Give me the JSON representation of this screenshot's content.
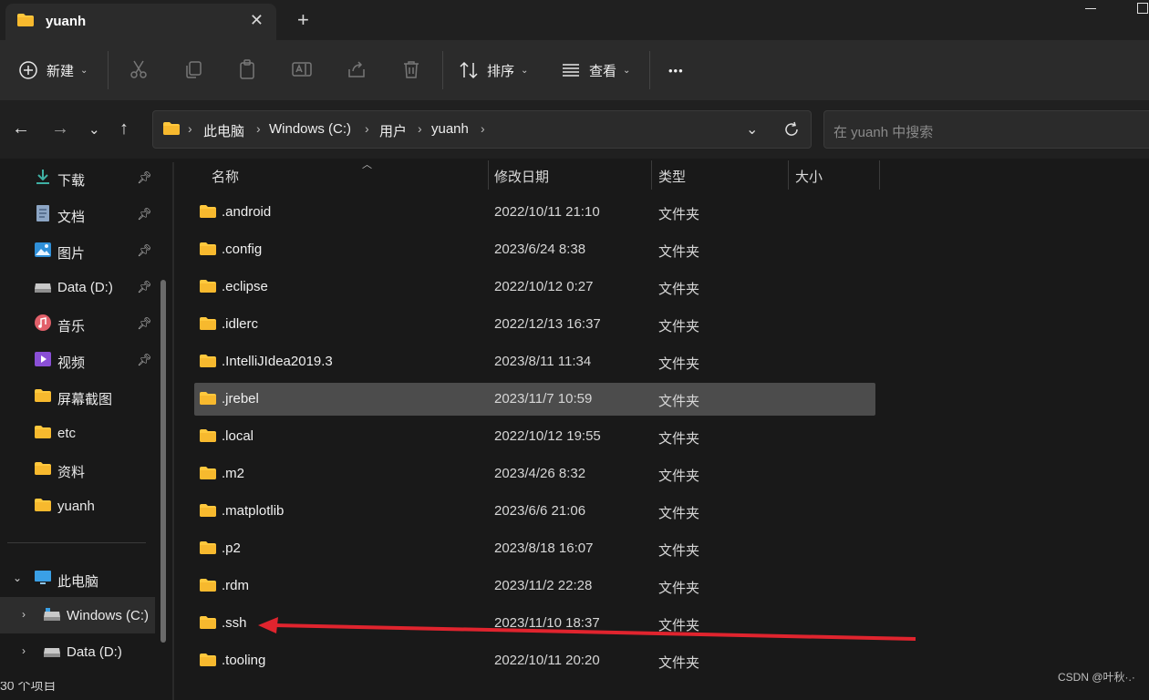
{
  "window": {
    "tab_title": "yuanh",
    "close_tab": "✕",
    "new_tab": "+"
  },
  "toolbar": {
    "new_label": "新建",
    "sort_label": "排序",
    "view_label": "查看",
    "more_label": "•••"
  },
  "nav": {
    "breadcrumbs": [
      "此电脑",
      "Windows (C:)",
      "用户",
      "yuanh"
    ],
    "search_placeholder": "在 yuanh 中搜索"
  },
  "sidebar": {
    "quick_access": [
      {
        "label": "下载",
        "icon": "download-icon",
        "pinned": true
      },
      {
        "label": "文档",
        "icon": "document-icon",
        "pinned": true
      },
      {
        "label": "图片",
        "icon": "picture-icon",
        "pinned": true
      },
      {
        "label": "Data (D:)",
        "icon": "drive-icon",
        "pinned": true
      },
      {
        "label": "音乐",
        "icon": "music-icon",
        "pinned": true
      },
      {
        "label": "视频",
        "icon": "video-icon",
        "pinned": true
      },
      {
        "label": "屏幕截图",
        "icon": "folder-icon",
        "pinned": false
      },
      {
        "label": "etc",
        "icon": "folder-icon",
        "pinned": false
      },
      {
        "label": "资料",
        "icon": "folder-icon",
        "pinned": false
      },
      {
        "label": "yuanh",
        "icon": "folder-icon",
        "pinned": false
      }
    ],
    "this_pc": "此电脑",
    "drives": [
      "Windows (C:)",
      "Data (D:)"
    ]
  },
  "columns": {
    "name": "名称",
    "modified": "修改日期",
    "type": "类型",
    "size": "大小"
  },
  "files": [
    {
      "name": ".android",
      "modified": "2022/10/11 21:10",
      "type": "文件夹"
    },
    {
      "name": ".config",
      "modified": "2023/6/24 8:38",
      "type": "文件夹"
    },
    {
      "name": ".eclipse",
      "modified": "2022/10/12 0:27",
      "type": "文件夹"
    },
    {
      "name": ".idlerc",
      "modified": "2022/12/13 16:37",
      "type": "文件夹"
    },
    {
      "name": ".IntelliJIdea2019.3",
      "modified": "2023/8/11 11:34",
      "type": "文件夹"
    },
    {
      "name": ".jrebel",
      "modified": "2023/11/7 10:59",
      "type": "文件夹",
      "selected": true
    },
    {
      "name": ".local",
      "modified": "2022/10/12 19:55",
      "type": "文件夹"
    },
    {
      "name": ".m2",
      "modified": "2023/4/26 8:32",
      "type": "文件夹"
    },
    {
      "name": ".matplotlib",
      "modified": "2023/6/6 21:06",
      "type": "文件夹"
    },
    {
      "name": ".p2",
      "modified": "2023/8/18 16:07",
      "type": "文件夹"
    },
    {
      "name": ".rdm",
      "modified": "2023/11/2 22:28",
      "type": "文件夹"
    },
    {
      "name": ".ssh",
      "modified": "2023/11/10 18:37",
      "type": "文件夹"
    },
    {
      "name": ".tooling",
      "modified": "2022/10/11 20:20",
      "type": "文件夹"
    }
  ],
  "status": {
    "item_count": "30 个项目"
  },
  "watermark": "CSDN @叶秋·.·",
  "colors": {
    "accent": "#ffc83d",
    "annotation_arrow": "#e0242e",
    "selected_row": "#4c4c4c"
  }
}
